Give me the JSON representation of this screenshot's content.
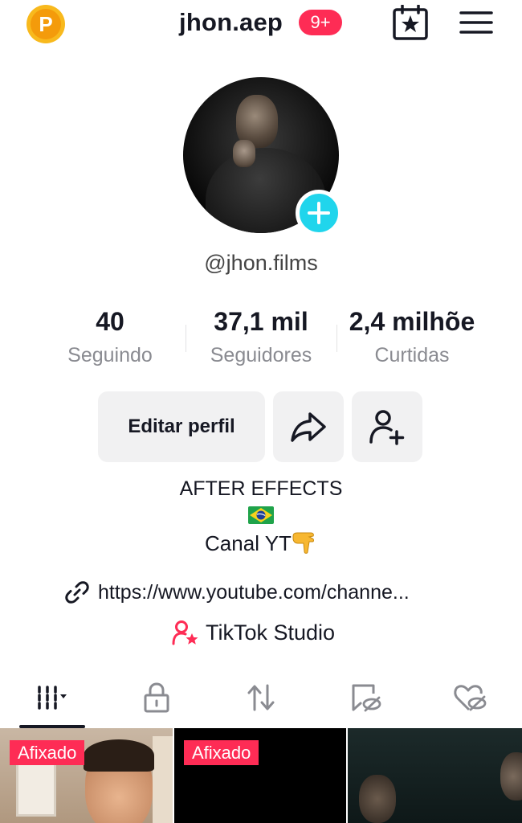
{
  "header": {
    "username": "jhon.aep",
    "notification_badge": "9+",
    "coin_letter": "P"
  },
  "profile": {
    "handle": "@jhon.films",
    "stats": [
      {
        "value": "40",
        "label": "Seguindo"
      },
      {
        "value": "37,1 mil",
        "label": "Seguidores"
      },
      {
        "value": "2,4 milhõe",
        "label": "Curtidas"
      }
    ],
    "buttons": {
      "edit_label": "Editar perfil"
    },
    "bio": {
      "line1": "AFTER EFFECTS",
      "line3": "Canal YT"
    },
    "link": "https://www.youtube.com/channe...",
    "studio_label": "TikTok Studio"
  },
  "tabs": {
    "items": [
      "grid",
      "private",
      "reposts",
      "favorites",
      "liked"
    ],
    "active": "grid"
  },
  "videos": [
    {
      "badge": "Afixado"
    },
    {
      "badge": "Afixado"
    },
    {
      "badge": ""
    }
  ],
  "colors": {
    "accent": "#fe2c55",
    "add_button": "#20d5ec",
    "coin": "#f8b91d",
    "secondary_text": "#8a8b91",
    "button_bg": "#f1f1f2"
  }
}
